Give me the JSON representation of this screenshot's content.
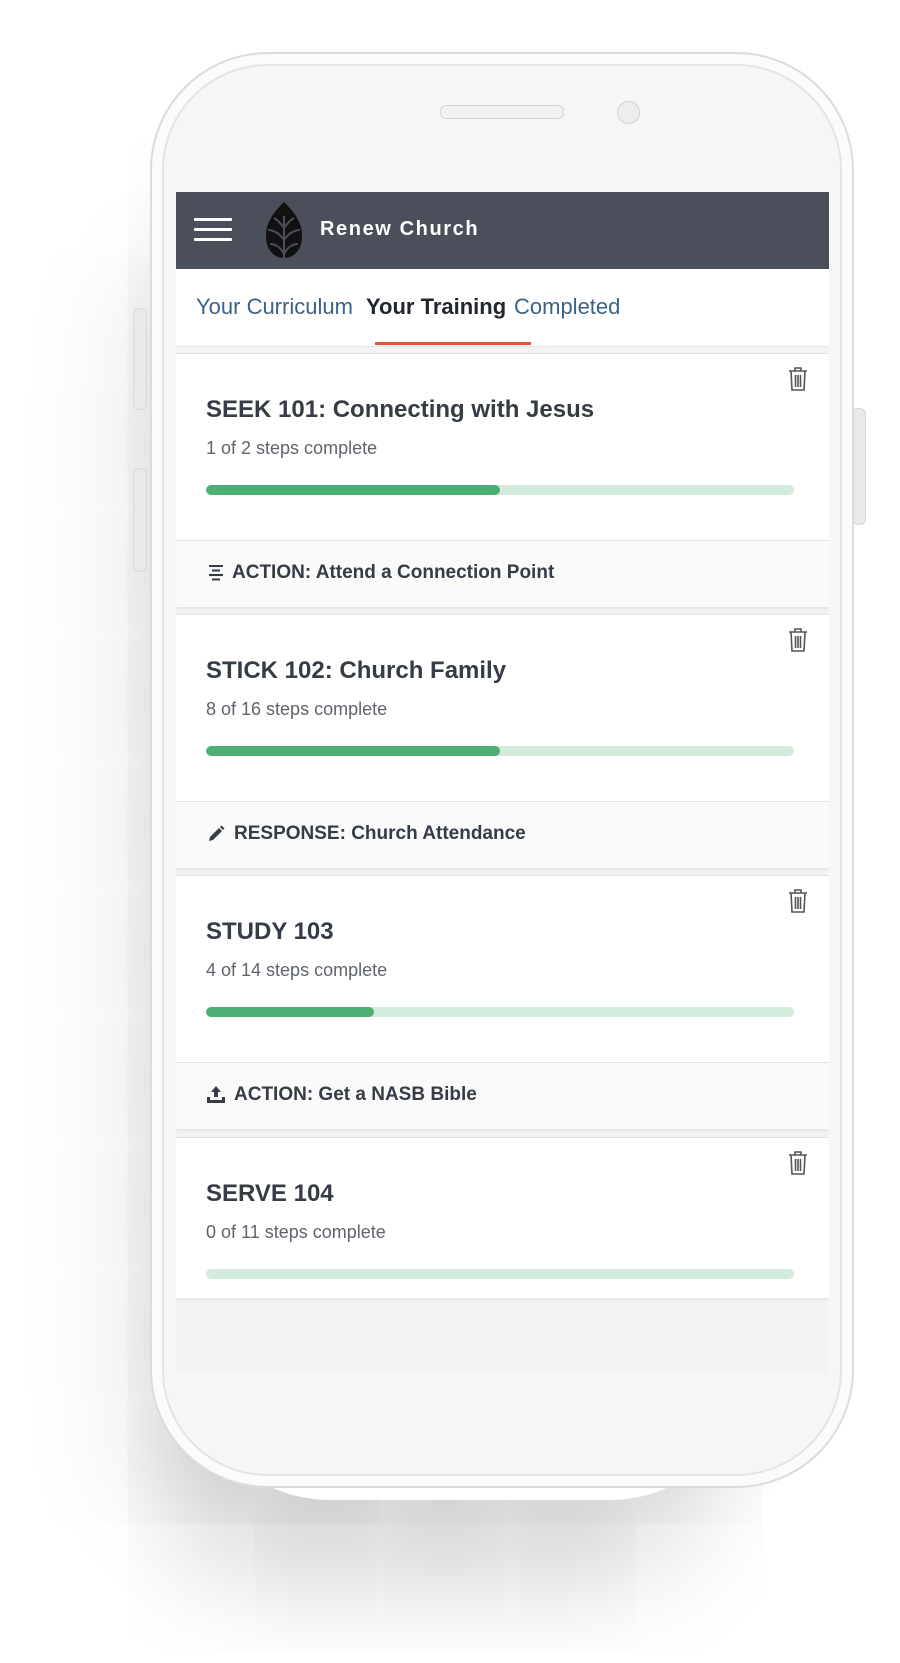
{
  "app": {
    "brand": "Renew Church"
  },
  "tabs": [
    {
      "label": "Your Curriculum",
      "active": false
    },
    {
      "label": "Your Training",
      "active": true
    },
    {
      "label": "Completed",
      "active": false
    }
  ],
  "courses": [
    {
      "title": "SEEK 101: Connecting with Jesus",
      "status": "1 of 2 steps complete",
      "progress_fraction": 0.5,
      "action_icon": "align-center-icon",
      "action_label": "ACTION: Attend a Connection Point"
    },
    {
      "title": "STICK 102: Church Family",
      "status": "8 of 16 steps complete",
      "progress_fraction": 0.5,
      "action_icon": "pencil-icon",
      "action_label": "RESPONSE: Church Attendance"
    },
    {
      "title": "STUDY 103",
      "status": "4 of 14 steps complete",
      "progress_fraction": 0.2857,
      "action_icon": "upload-icon",
      "action_label": "ACTION: Get a NASB Bible"
    },
    {
      "title": "SERVE 104",
      "status": "0 of 11 steps complete",
      "progress_fraction": 0
    }
  ],
  "colors": {
    "header_bg": "#4b4f5a",
    "tab_link": "#3c6288",
    "tab_active_underline": "#e0563a",
    "progress_fill": "#4caf73",
    "progress_track": "#d3ebdd"
  }
}
